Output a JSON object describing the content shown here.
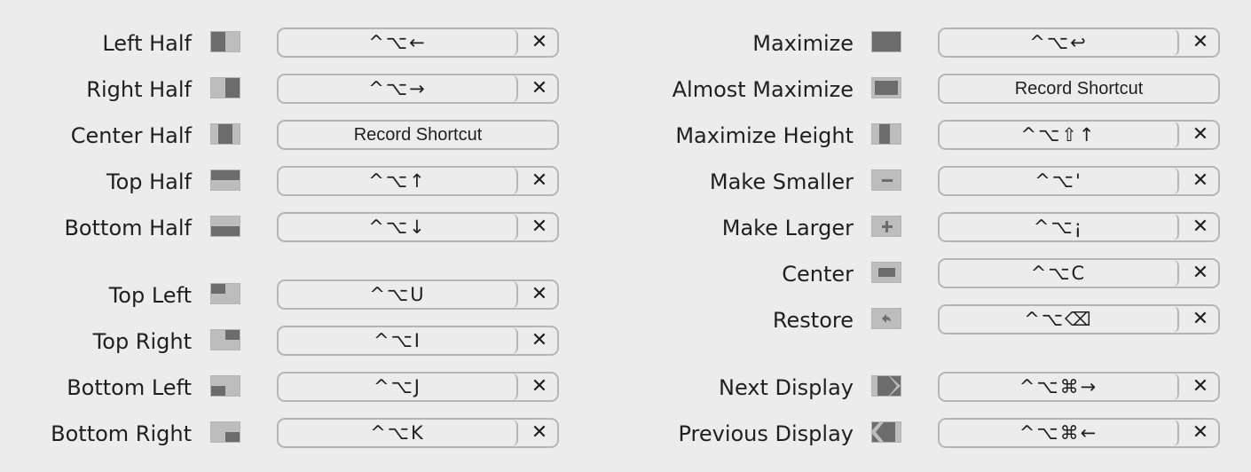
{
  "left_column": [
    {
      "label": "Left Half",
      "icon": "left-half-icon",
      "shortcut": "^⌥←",
      "clear": "✕"
    },
    {
      "label": "Right Half",
      "icon": "right-half-icon",
      "shortcut": "^⌥→",
      "clear": "✕"
    },
    {
      "label": "Center Half",
      "icon": "center-half-icon",
      "shortcut": "Record Shortcut",
      "clear": ""
    },
    {
      "label": "Top Half",
      "icon": "top-half-icon",
      "shortcut": "^⌥↑",
      "clear": "✕"
    },
    {
      "label": "Bottom Half",
      "icon": "bottom-half-icon",
      "shortcut": "^⌥↓",
      "clear": "✕"
    },
    {
      "label": "Top Left",
      "icon": "top-left-icon",
      "shortcut": "^⌥U",
      "clear": "✕"
    },
    {
      "label": "Top Right",
      "icon": "top-right-icon",
      "shortcut": "^⌥I",
      "clear": "✕"
    },
    {
      "label": "Bottom Left",
      "icon": "bottom-left-icon",
      "shortcut": "^⌥J",
      "clear": "✕"
    },
    {
      "label": "Bottom Right",
      "icon": "bottom-right-icon",
      "shortcut": "^⌥K",
      "clear": "✕"
    }
  ],
  "right_column": [
    {
      "label": "Maximize",
      "icon": "maximize-icon",
      "shortcut": "^⌥↩",
      "clear": "✕"
    },
    {
      "label": "Almost Maximize",
      "icon": "almost-maximize-icon",
      "shortcut": "Record Shortcut",
      "clear": ""
    },
    {
      "label": "Maximize Height",
      "icon": "maximize-height-icon",
      "shortcut": "^⌥⇧↑",
      "clear": "✕"
    },
    {
      "label": "Make Smaller",
      "icon": "make-smaller-icon",
      "shortcut": "^⌥'",
      "clear": "✕"
    },
    {
      "label": "Make Larger",
      "icon": "make-larger-icon",
      "shortcut": "^⌥¡",
      "clear": "✕"
    },
    {
      "label": "Center",
      "icon": "center-icon",
      "shortcut": "^⌥C",
      "clear": "✕"
    },
    {
      "label": "Restore",
      "icon": "restore-icon",
      "shortcut": "^⌥⌫",
      "clear": "✕"
    },
    {
      "label": "Next Display",
      "icon": "next-display-icon",
      "shortcut": "^⌥⌘→",
      "clear": "✕"
    },
    {
      "label": "Previous Display",
      "icon": "previous-display-icon",
      "shortcut": "^⌥⌘←",
      "clear": "✕"
    }
  ],
  "colors": {
    "background": "#ececec",
    "icon_light": "#bdbdbd",
    "icon_dark": "#6c6c6c",
    "border": "#b6b6b6",
    "text": "#1f1f1f"
  }
}
